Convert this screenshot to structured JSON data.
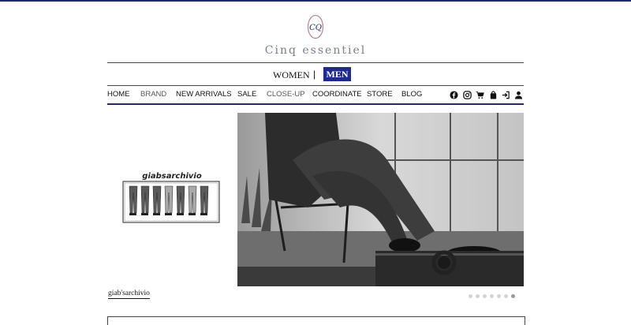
{
  "brand": {
    "monogram": "CQ",
    "name": "Cinq essentiel"
  },
  "gender_switch": {
    "women_label": "WOMEN",
    "separator": "|",
    "men_label": "MEN",
    "active": "MEN",
    "active_color": "#1f2a8f"
  },
  "nav": {
    "items": [
      {
        "label": "HOME"
      },
      {
        "label": "BRAND"
      },
      {
        "label": "NEW ARRIVALS"
      },
      {
        "label": "SALE"
      },
      {
        "label": "CLOSE-UP"
      },
      {
        "label": "COORDINATE"
      },
      {
        "label": "STORE"
      },
      {
        "label": "BLOG"
      }
    ],
    "icons": [
      "facebook-icon",
      "instagram-icon",
      "cart-icon",
      "shopping-bag-icon",
      "login-icon",
      "user-icon"
    ]
  },
  "feature": {
    "logo_text": "giabsarchivio",
    "caption": "giab'sarchivio"
  },
  "carousel": {
    "slide_count": 7,
    "active_index": 6
  },
  "colors": {
    "accent": "#1f2a6b",
    "men_button": "#1f2a8f"
  }
}
